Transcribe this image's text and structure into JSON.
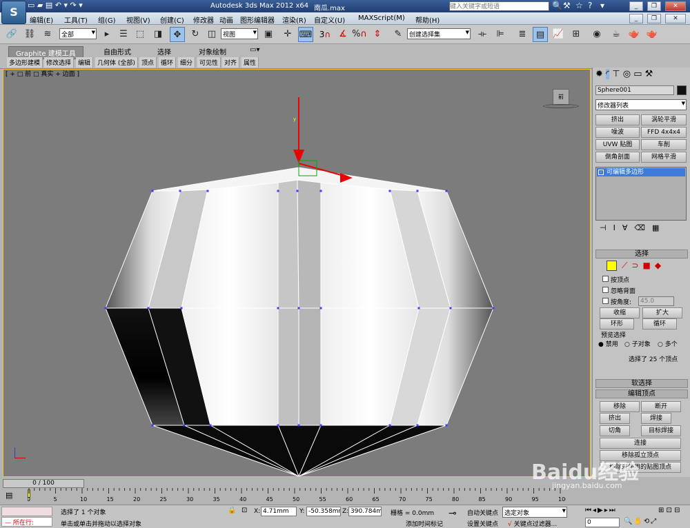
{
  "title": {
    "app": "Autodesk 3ds Max  2012 x64",
    "file": "南瓜.max",
    "search_placeholder": "键入关键字或短语"
  },
  "menu": [
    "编辑(E)",
    "工具(T)",
    "组(G)",
    "视图(V)",
    "创建(C)",
    "修改器",
    "动画",
    "图形编辑器",
    "渲染(R)",
    "自定义(U)",
    "MAXScript(M)",
    "帮助(H)"
  ],
  "toolbar": {
    "selection_filter": "全部",
    "ref_coord": "视图",
    "named_selection": "创建选择集",
    "snap_label": "3",
    "percent_label": "%"
  },
  "ribbon": {
    "tabs": [
      "Graphite 建模工具",
      "自由形式",
      "选择",
      "对象绘制"
    ],
    "subtabs": [
      "多边形建模",
      "修改选择",
      "编辑",
      "几何体 (全部)",
      "顶点",
      "循环",
      "细分",
      "可见性",
      "对齐",
      "属性"
    ]
  },
  "viewport": {
    "label": "[ + □ 前 □ 真实 + 边面 ]",
    "viewcube_label": "前"
  },
  "command_panel": {
    "object_name": "Sphere001",
    "modifier_list": "修改器列表",
    "modifier_buttons": [
      "挤出",
      "涡轮平滑",
      "噪波",
      "FFD 4x4x4",
      "UVW 贴图",
      "车削",
      "倒角剖面",
      "网格平滑"
    ],
    "stack_item": "可编辑多边形",
    "selection_rollout": {
      "title": "选择",
      "by_vertex": "按顶点",
      "ignore_backfacing": "忽略背面",
      "by_angle": "按角度:",
      "angle_value": "45.0",
      "shrink": "收缩",
      "grow": "扩大",
      "ring": "环形",
      "loop": "循环",
      "preview_title": "预览选择",
      "preview_options": [
        "禁用",
        "子对象",
        "多个"
      ],
      "status": "选择了 25 个顶点"
    },
    "soft_selection_title": "软选择",
    "edit_vertices": {
      "title": "编辑顶点",
      "buttons": [
        "移除",
        "断开",
        "挤出",
        "焊接",
        "切角",
        "目标焊接",
        "连接",
        "移除孤立顶点",
        "移除未使用的贴图顶点"
      ]
    }
  },
  "timeline": {
    "frame_display": "0 / 100",
    "ticks": [
      "0",
      "5",
      "10",
      "15",
      "20",
      "25",
      "30",
      "35",
      "40",
      "45",
      "50",
      "55",
      "60",
      "65",
      "70",
      "75",
      "80",
      "85",
      "90",
      "95",
      "100"
    ]
  },
  "status": {
    "now_running": "所在行:",
    "selected": "选择了 1 个对象",
    "prompt": "单击或单击并拖动以选择对象",
    "x_label": "X:",
    "x": "4.71mm",
    "y_label": "Y:",
    "y": "-50.358mm",
    "z_label": "Z:",
    "z": "390.784mm",
    "grid": "栅格 = 0.0mm",
    "auto_key": "自动关键点",
    "selected_dropdown": "选定对象",
    "set_key": "设置关键点",
    "key_filters": "关键点过滤器...",
    "add_time_tag": "添加时间标记",
    "frame": "0"
  },
  "watermark": {
    "brand": "Baidu经验",
    "url": "jingyan.baidu.com"
  },
  "colors": {
    "title_bar": "#2a4a82",
    "viewport_bg": "#7c7c7c",
    "active_border": "#fbc02d",
    "selection_blue": "#3d7bd8",
    "vertex": "#3b3bff"
  }
}
